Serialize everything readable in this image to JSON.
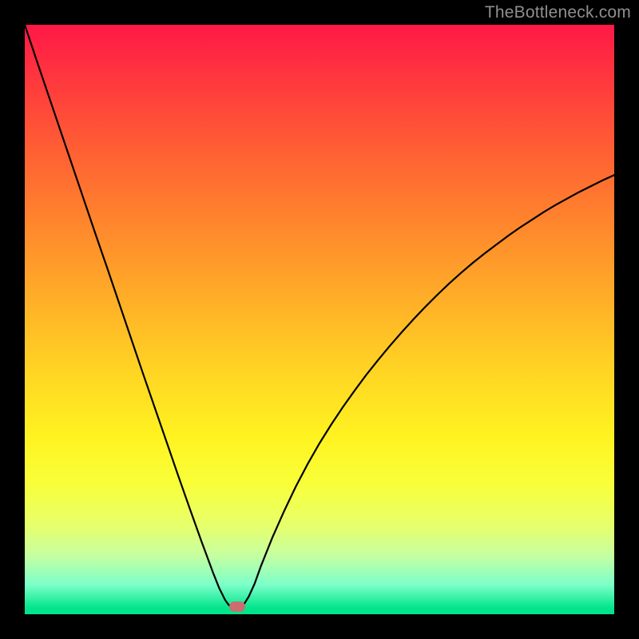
{
  "watermark": "TheBottleneck.com",
  "marker": {
    "cx_frac": 0.36,
    "cy_frac": 0.987
  },
  "chart_data": {
    "type": "line",
    "title": "",
    "xlabel": "",
    "ylabel": "",
    "xlim": [
      0,
      1
    ],
    "ylim": [
      0,
      1
    ],
    "x": [
      0.0,
      0.02,
      0.04,
      0.06,
      0.08,
      0.1,
      0.12,
      0.14,
      0.16,
      0.18,
      0.2,
      0.22,
      0.24,
      0.26,
      0.28,
      0.3,
      0.31,
      0.32,
      0.33,
      0.34,
      0.345,
      0.35,
      0.355,
      0.36,
      0.365,
      0.37,
      0.38,
      0.39,
      0.4,
      0.42,
      0.44,
      0.46,
      0.48,
      0.5,
      0.52,
      0.54,
      0.56,
      0.58,
      0.6,
      0.62,
      0.64,
      0.66,
      0.68,
      0.7,
      0.72,
      0.74,
      0.76,
      0.78,
      0.8,
      0.82,
      0.84,
      0.86,
      0.88,
      0.9,
      0.92,
      0.94,
      0.96,
      0.98,
      1.0
    ],
    "y": [
      0.0,
      0.06,
      0.119,
      0.178,
      0.237,
      0.296,
      0.355,
      0.413,
      0.472,
      0.531,
      0.59,
      0.648,
      0.706,
      0.764,
      0.821,
      0.877,
      0.904,
      0.931,
      0.956,
      0.976,
      0.983,
      0.988,
      0.99,
      0.991,
      0.99,
      0.986,
      0.97,
      0.948,
      0.92,
      0.87,
      0.825,
      0.783,
      0.745,
      0.71,
      0.678,
      0.648,
      0.62,
      0.593,
      0.568,
      0.544,
      0.521,
      0.499,
      0.478,
      0.458,
      0.439,
      0.421,
      0.404,
      0.388,
      0.373,
      0.358,
      0.344,
      0.331,
      0.318,
      0.306,
      0.295,
      0.284,
      0.274,
      0.264,
      0.255
    ],
    "marker": {
      "x": 0.36,
      "y": 0.987
    },
    "background_gradient": {
      "direction": "vertical",
      "stops": [
        {
          "pos": 0.0,
          "color": "#ff1846"
        },
        {
          "pos": 0.35,
          "color": "#ff8a2c"
        },
        {
          "pos": 0.6,
          "color": "#ffd823"
        },
        {
          "pos": 0.8,
          "color": "#f0ff55"
        },
        {
          "pos": 1.0,
          "color": "#00e58b"
        }
      ]
    }
  }
}
